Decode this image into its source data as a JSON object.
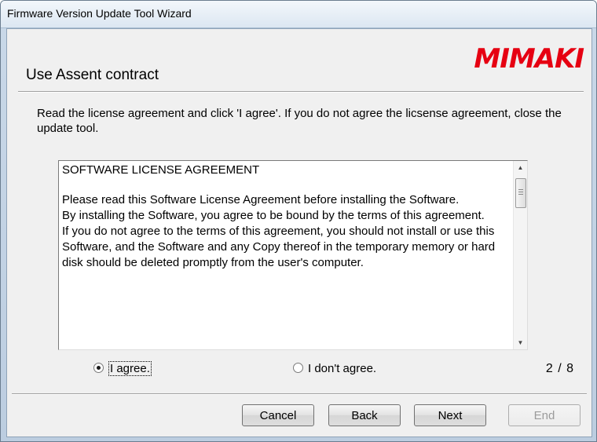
{
  "window": {
    "title": "Firmware Version Update Tool Wizard"
  },
  "header": {
    "title": "Use Assent contract",
    "logo_text": "MIMAKI",
    "logo_color": "#e60012"
  },
  "instructions": "Read the license agreement and click 'I agree'. If you do not agree the licsense agreement, close the update tool.",
  "license": {
    "lines": [
      "SOFTWARE LICENSE AGREEMENT",
      "Please read this Software License Agreement before installing the Software.",
      "By installing the Software, you agree to be bound by the terms of this agreement.",
      "If you do not agree to the terms of this agreement, you should not install or use this Software, and the Software and any Copy thereof in the temporary memory or hard disk should be deleted promptly from the user's computer."
    ]
  },
  "options": {
    "agree": {
      "label": "I agree.",
      "selected": true
    },
    "disagree": {
      "label": "I don't agree.",
      "selected": false
    }
  },
  "page_indicator": "2 / 8",
  "buttons": {
    "cancel": "Cancel",
    "back": "Back",
    "next": "Next",
    "end": {
      "label": "End",
      "disabled": true
    }
  }
}
